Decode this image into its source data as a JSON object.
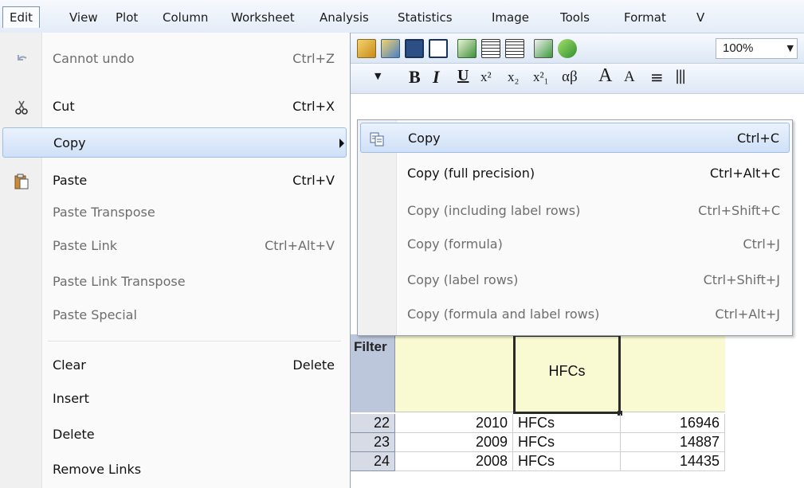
{
  "menubar": {
    "items": [
      {
        "label": "Edit"
      },
      {
        "label": "View"
      },
      {
        "label": "Plot"
      },
      {
        "label": "Column"
      },
      {
        "label": "Worksheet"
      },
      {
        "label": "Analysis"
      },
      {
        "label": "Statistics"
      },
      {
        "label": "Image"
      },
      {
        "label": "Tools"
      },
      {
        "label": "Format"
      },
      {
        "label": "V"
      }
    ]
  },
  "toolbar": {
    "zoom": "100%",
    "format_buttons": {
      "bold": "B",
      "italic": "I",
      "underline": "U",
      "greek": "αβ"
    }
  },
  "edit_menu": {
    "items": [
      {
        "label": "Cannot undo",
        "shortcut": "Ctrl+Z",
        "icon": "undo-icon"
      },
      {
        "label": "Cut",
        "shortcut": "Ctrl+X",
        "icon": "scissors-icon"
      },
      {
        "label": "Copy",
        "shortcut": ""
      },
      {
        "label": "Paste",
        "shortcut": "Ctrl+V",
        "icon": "clipboard-icon"
      },
      {
        "label": "Paste Transpose",
        "shortcut": ""
      },
      {
        "label": "Paste Link",
        "shortcut": "Ctrl+Alt+V"
      },
      {
        "label": "Paste Link Transpose",
        "shortcut": ""
      },
      {
        "label": "Paste Special",
        "shortcut": ""
      },
      {
        "label": "Clear",
        "shortcut": "Delete"
      },
      {
        "label": "Insert",
        "shortcut": ""
      },
      {
        "label": "Delete",
        "shortcut": ""
      },
      {
        "label": "Remove Links",
        "shortcut": ""
      }
    ]
  },
  "copy_submenu": {
    "items": [
      {
        "label": "Copy",
        "shortcut": "Ctrl+C",
        "icon": "copy-icon"
      },
      {
        "label": "Copy (full precision)",
        "shortcut": "Ctrl+Alt+C"
      },
      {
        "label": "Copy (including label rows)",
        "shortcut": "Ctrl+Shift+C"
      },
      {
        "label": "Copy (formula)",
        "shortcut": "Ctrl+J"
      },
      {
        "label": "Copy (label rows)",
        "shortcut": "Ctrl+Shift+J"
      },
      {
        "label": "Copy (formula and label rows)",
        "shortcut": "Ctrl+Alt+J"
      }
    ]
  },
  "worksheet": {
    "filter_label": "Filter",
    "selected_cell": "HFCs",
    "rows": [
      {
        "index": "22",
        "year": "2010",
        "gas": "HFCs",
        "amount": "16946"
      },
      {
        "index": "23",
        "year": "2009",
        "gas": "HFCs",
        "amount": "14887"
      },
      {
        "index": "24",
        "year": "2008",
        "gas": "HFCs",
        "amount": "14435"
      }
    ]
  },
  "colors": {
    "menu_hover": "#cfe0f7",
    "label_row": "#fafad2",
    "row_header": "#d6dbe6"
  }
}
